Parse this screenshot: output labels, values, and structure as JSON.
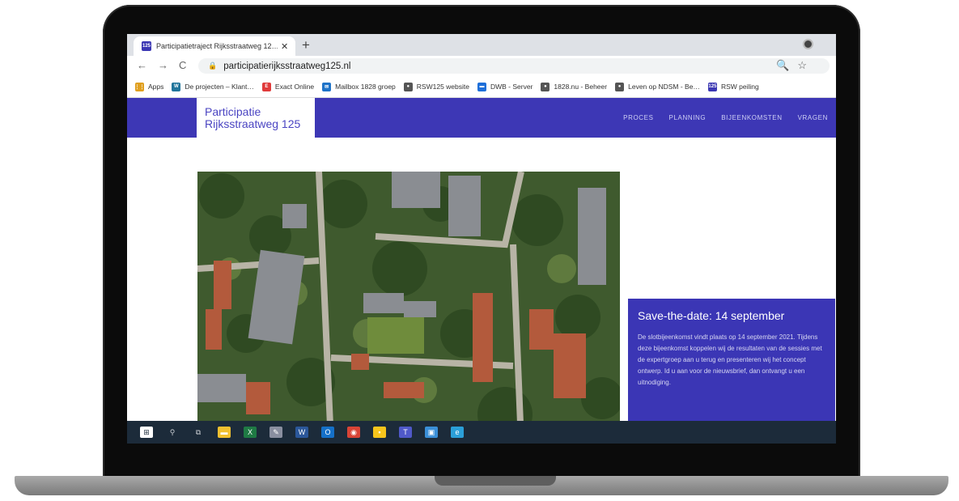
{
  "browser": {
    "tab_title": "Participatietraject Rijksstraatweg 12…",
    "tab_close": "✕",
    "new_tab": "+",
    "favicon_text": "125",
    "url": "participatierijksstraatweg125.nl",
    "nav_back": "←",
    "nav_forward": "→",
    "nav_reload": "C",
    "lock_icon": "🔒",
    "omni_actions": "🔍☆",
    "bookmarks": [
      {
        "label": "Apps",
        "icon": "apps-grid-icon",
        "color": "#e0a020",
        "glyph": "⋮⋮"
      },
      {
        "label": "De projecten – Klant…",
        "icon": "wordpress-icon",
        "color": "#21759b",
        "glyph": "W"
      },
      {
        "label": "Exact Online",
        "icon": "exact-online-icon",
        "color": "#e03a3a",
        "glyph": "E"
      },
      {
        "label": "Mailbox 1828 groep",
        "icon": "mailbox-icon",
        "color": "#1e73c8",
        "glyph": "✉"
      },
      {
        "label": "RSW125 website",
        "icon": "globe-icon",
        "color": "#555555",
        "glyph": "●"
      },
      {
        "label": "DWB - Server",
        "icon": "server-icon",
        "color": "#1e6fd9",
        "glyph": "▬"
      },
      {
        "label": "1828.nu - Beheer",
        "icon": "globe-icon",
        "color": "#555555",
        "glyph": "●"
      },
      {
        "label": "Leven op NDSM - Be…",
        "icon": "globe-icon",
        "color": "#555555",
        "glyph": "●"
      },
      {
        "label": "RSW peiling",
        "icon": "rsw-icon",
        "color": "#3b37b3",
        "glyph": "125"
      }
    ]
  },
  "site": {
    "logo_line1": "Participatie",
    "logo_line2": "Rijksstraatweg 125",
    "nav": [
      "PROCES",
      "PLANNING",
      "BIJEENKOMSTEN",
      "VRAGEN"
    ],
    "card": {
      "title": "Save-the-date: 14 september",
      "body": "De slotbijeenkomst vindt plaats op 14 september 2021. Tijdens deze bijeenkomst koppelen wij de resultaten van de sessies met de expertgroep aan u terug en presenteren wij het concept ontwerp. Id u aan voor de nieuwsbrief, dan ontvangt u een uitnodiging."
    }
  },
  "taskbar": [
    {
      "icon": "windows-start-icon",
      "color": "#ffffff",
      "glyph": "⊞"
    },
    {
      "icon": "search-icon",
      "color": "#1c2b3a",
      "glyph": "⚲"
    },
    {
      "icon": "task-view-icon",
      "color": "#1c2b3a",
      "glyph": "⧉"
    },
    {
      "icon": "file-explorer-icon",
      "color": "#f0c030",
      "glyph": "▬"
    },
    {
      "icon": "excel-icon",
      "color": "#1f7a44",
      "glyph": "X"
    },
    {
      "icon": "paint-icon",
      "color": "#8a8fa0",
      "glyph": "✎"
    },
    {
      "icon": "word-icon",
      "color": "#2b579a",
      "glyph": "W"
    },
    {
      "icon": "outlook-icon",
      "color": "#1570c8",
      "glyph": "O"
    },
    {
      "icon": "chrome-icon",
      "color": "#d94436",
      "glyph": "◉"
    },
    {
      "icon": "sticky-notes-icon",
      "color": "#f7c51c",
      "glyph": "▪"
    },
    {
      "icon": "teams-icon",
      "color": "#5059c9",
      "glyph": "T"
    },
    {
      "icon": "photos-icon",
      "color": "#3a8fd8",
      "glyph": "▣"
    },
    {
      "icon": "edge-icon",
      "color": "#2b9fd8",
      "glyph": "e"
    }
  ]
}
